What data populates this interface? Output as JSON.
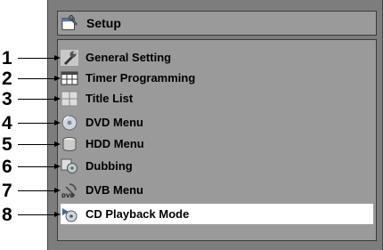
{
  "header": {
    "title": "Setup",
    "icon": "setup-icon"
  },
  "menu": {
    "items": [
      {
        "number": "1",
        "label": "General Setting",
        "icon": "wrench-icon",
        "selected": false
      },
      {
        "number": "2",
        "label": "Timer Programming",
        "icon": "timer-programming-icon",
        "selected": false
      },
      {
        "number": "3",
        "label": "Title List",
        "icon": "title-list-icon",
        "selected": false
      },
      {
        "number": "4",
        "label": "DVD Menu",
        "icon": "dvd-disc-icon",
        "selected": false
      },
      {
        "number": "5",
        "label": "HDD Menu",
        "icon": "hdd-icon",
        "selected": false
      },
      {
        "number": "6",
        "label": "Dubbing",
        "icon": "dubbing-icon",
        "selected": false
      },
      {
        "number": "7",
        "label": "DVB Menu",
        "icon": "dvb-icon",
        "selected": false
      },
      {
        "number": "8",
        "label": "CD Playback Mode",
        "icon": "cd-playback-icon",
        "selected": true
      }
    ]
  },
  "colors": {
    "panel": "#7d7d7d",
    "box": "#9a9a9a",
    "selected_row": "#ffffff"
  }
}
